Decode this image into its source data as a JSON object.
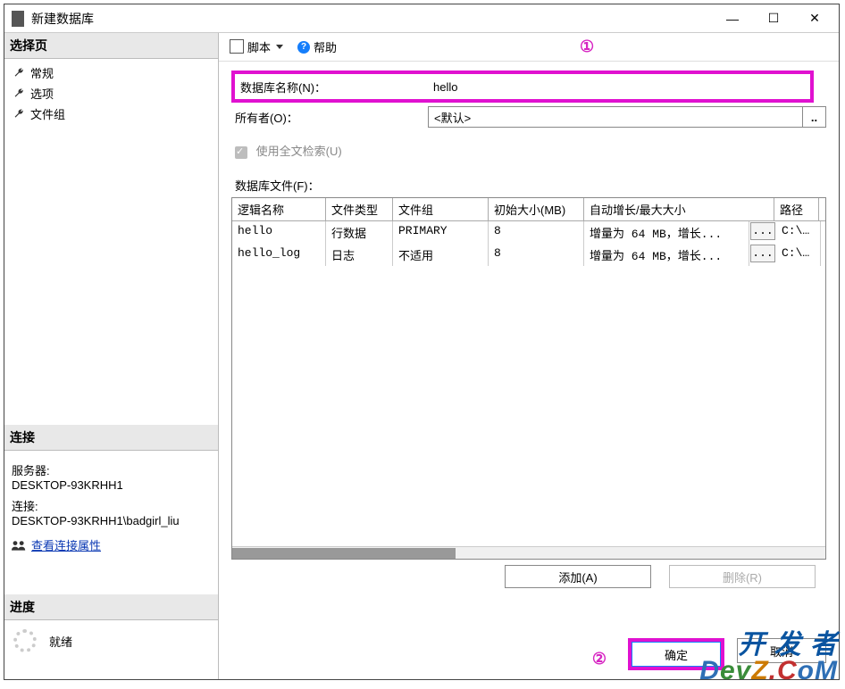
{
  "window": {
    "title": "新建数据库"
  },
  "sidebar": {
    "select_page": "选择页",
    "items": [
      "常规",
      "选项",
      "文件组"
    ],
    "connection_header": "连接",
    "server_label": "服务器:",
    "server_value": "DESKTOP-93KRHH1",
    "conn_label": "连接:",
    "conn_value": "DESKTOP-93KRHH1\\badgirl_liu",
    "view_props": "查看连接属性",
    "progress_header": "进度",
    "progress_value": "就绪"
  },
  "toolbar": {
    "script": "脚本",
    "help": "帮助"
  },
  "annotations": {
    "one": "①",
    "two": "②"
  },
  "form": {
    "dbname_label": "数据库名称(N)：",
    "dbname_value": "hello",
    "owner_label": "所有者(O)：",
    "owner_value": "<默认>",
    "owner_browse": "..",
    "fulltext_label": "使用全文检索(U)",
    "files_label": "数据库文件(F)："
  },
  "grid": {
    "headers": [
      "逻辑名称",
      "文件类型",
      "文件组",
      "初始大小(MB)",
      "自动增长/最大大小",
      "路径"
    ],
    "rows": [
      {
        "name": "hello",
        "type": "行数据",
        "group": "PRIMARY",
        "size": "8",
        "growth": "增量为 64 MB，增长...",
        "browse": "...",
        "path": "C:\\Pr"
      },
      {
        "name": "hello_log",
        "type": "日志",
        "group": "不适用",
        "size": "8",
        "growth": "增量为 64 MB，增长...",
        "browse": "...",
        "path": "C:\\Pr"
      }
    ]
  },
  "buttons": {
    "add": "添加(A)",
    "remove": "删除(R)",
    "ok": "确定",
    "cancel": "取消"
  },
  "watermark": {
    "line1": "开 发 者",
    "line2": "DevZ.CoM"
  }
}
